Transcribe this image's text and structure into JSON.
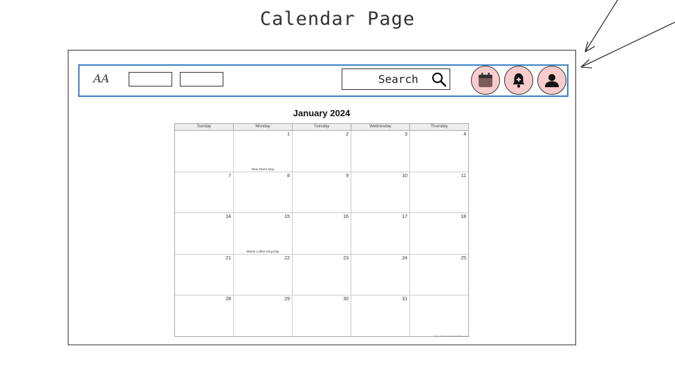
{
  "page": {
    "title": "Calendar Page"
  },
  "navbar": {
    "logo": "AA",
    "search": {
      "label": "Search",
      "icon": "search-icon"
    },
    "icons": [
      "calendar-icon",
      "bell-icon",
      "user-icon"
    ],
    "icon_bg_color": "#f8cccc",
    "border_color": "#3b82c4"
  },
  "calendar": {
    "title": "January 2024",
    "days": [
      "Sunday",
      "Monday",
      "Tuesday",
      "Wednesday",
      "Thursday"
    ],
    "weeks": [
      [
        {
          "day": ""
        },
        {
          "day": "1",
          "holiday": "New Year's Day"
        },
        {
          "day": "2"
        },
        {
          "day": "3"
        },
        {
          "day": "4"
        }
      ],
      [
        {
          "day": "7"
        },
        {
          "day": "8"
        },
        {
          "day": "9"
        },
        {
          "day": "10"
        },
        {
          "day": "11"
        }
      ],
      [
        {
          "day": "14"
        },
        {
          "day": "15",
          "holiday": "Martin Luther King Day"
        },
        {
          "day": "16"
        },
        {
          "day": "17"
        },
        {
          "day": "18"
        }
      ],
      [
        {
          "day": "21"
        },
        {
          "day": "22"
        },
        {
          "day": "23"
        },
        {
          "day": "24"
        },
        {
          "day": "25"
        }
      ],
      [
        {
          "day": "28"
        },
        {
          "day": "29"
        },
        {
          "day": "30"
        },
        {
          "day": "31"
        },
        {
          "day": ""
        }
      ]
    ],
    "footer": "http://www.calendarlabs.com"
  }
}
